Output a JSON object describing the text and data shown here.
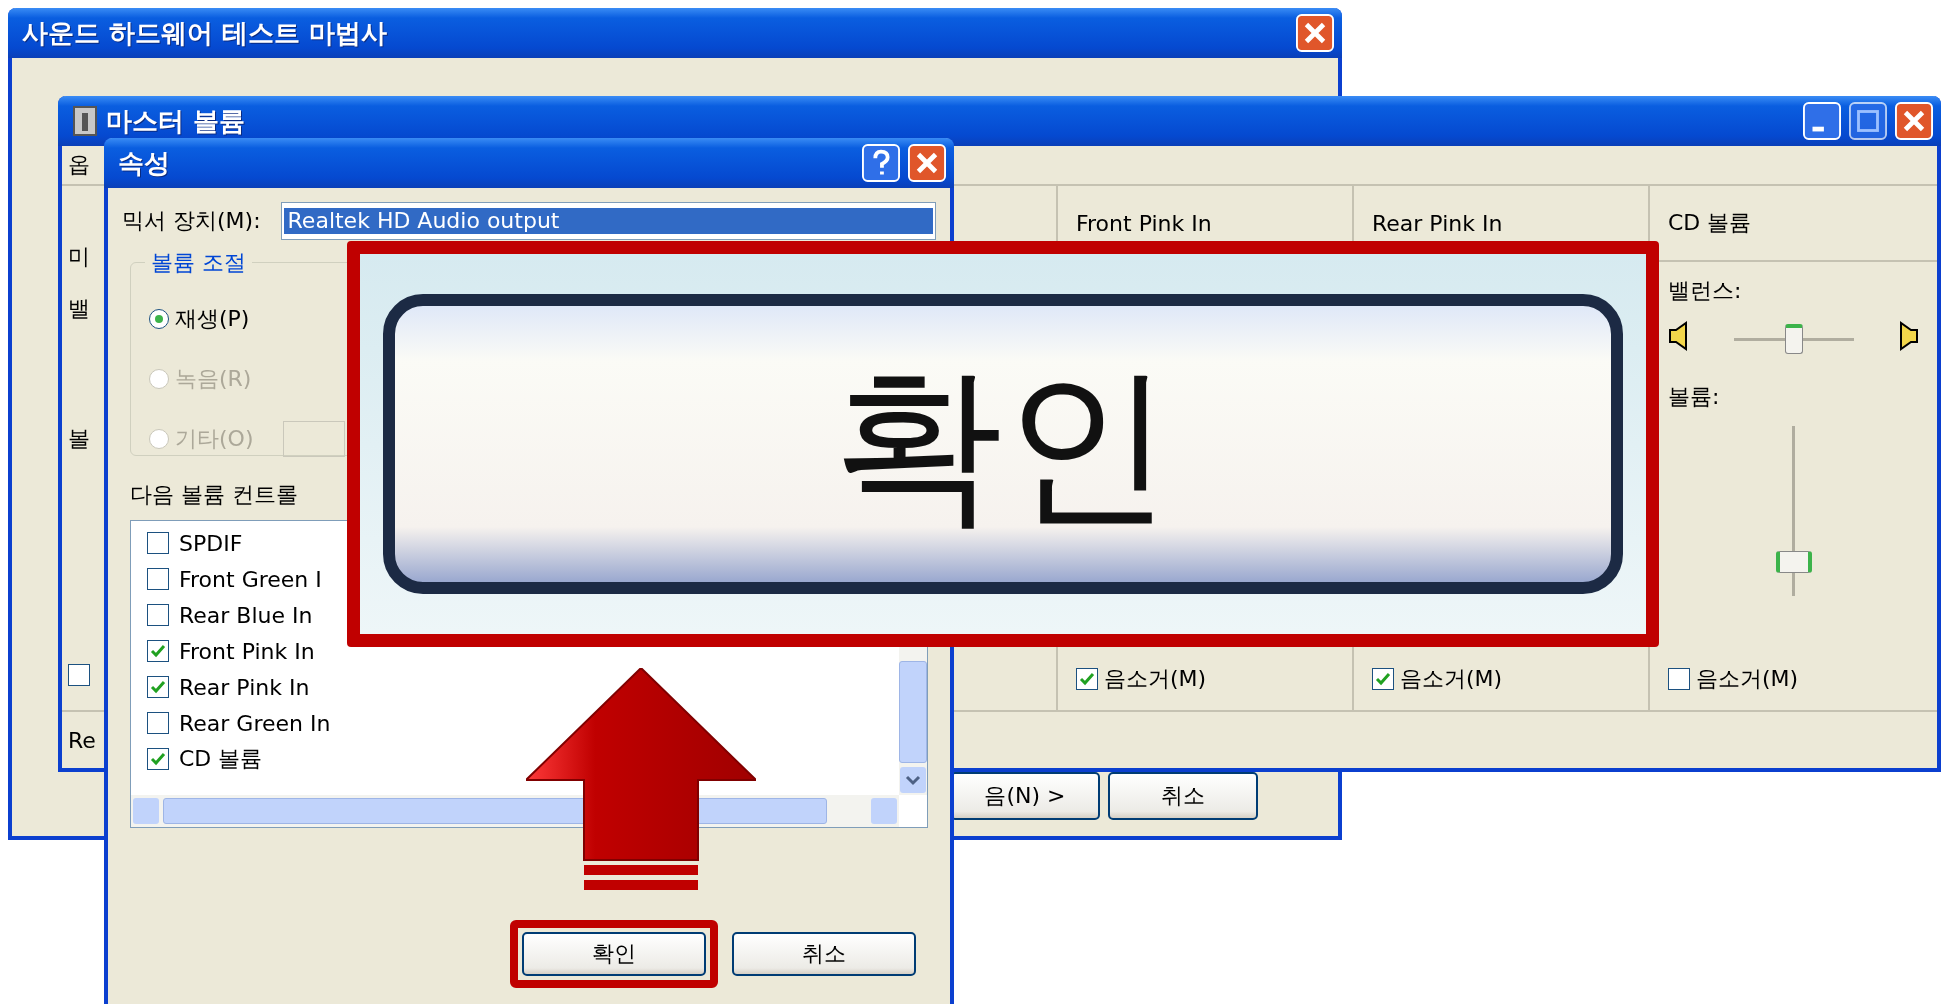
{
  "wizard_window": {
    "title": "사운드 하드웨어 테스트 마법사",
    "buttons": [
      {
        "label": "음(N) >"
      },
      {
        "label": "취소"
      }
    ]
  },
  "master_volume_window": {
    "title": "마스터 볼륨",
    "left_fragments": [
      "옵",
      "미",
      "밸",
      "볼"
    ],
    "left_mute_checked": false,
    "columns": [
      {
        "kind": "simple",
        "name": "Front Pink In",
        "mute_label": "음소거(M)",
        "muted": true
      },
      {
        "kind": "simple",
        "name": "Rear Pink In",
        "mute_label": "음소거(M)",
        "muted": true
      },
      {
        "kind": "full",
        "name": "CD 볼륨",
        "balance_label": "밸런스:",
        "balance": {
          "level": 0.5
        },
        "volume_label": "볼륨:",
        "volume": {
          "level": 0.2
        },
        "mute_label": "음소거(M)",
        "muted": false
      }
    ],
    "status_text": "Re"
  },
  "properties_dialog": {
    "title": "속성",
    "mixer_label": "믹서 장치(M):",
    "mixer_value": "Realtek HD Audio output",
    "group_title": "볼륨 조절",
    "radios": [
      {
        "label": "재생(P)",
        "selected": true,
        "disabled": false
      },
      {
        "label": "녹음(R)",
        "selected": false,
        "disabled": true
      },
      {
        "label": "기타(O)",
        "selected": false,
        "disabled": true
      }
    ],
    "list_label": "다음 볼륨 컨트롤",
    "controls": [
      {
        "label": "SPDIF",
        "checked": false
      },
      {
        "label": "Front Green I",
        "checked": false
      },
      {
        "label": "Rear Blue In",
        "checked": false
      },
      {
        "label": "Front Pink In",
        "checked": true
      },
      {
        "label": "Rear Pink In",
        "checked": true
      },
      {
        "label": "Rear Green In",
        "checked": false
      },
      {
        "label": "CD 볼륨",
        "checked": true
      }
    ],
    "buttons": [
      {
        "label": "확인",
        "highlighted": true
      },
      {
        "label": "취소",
        "highlighted": false
      }
    ]
  },
  "callout": {
    "button_label": "확인"
  }
}
